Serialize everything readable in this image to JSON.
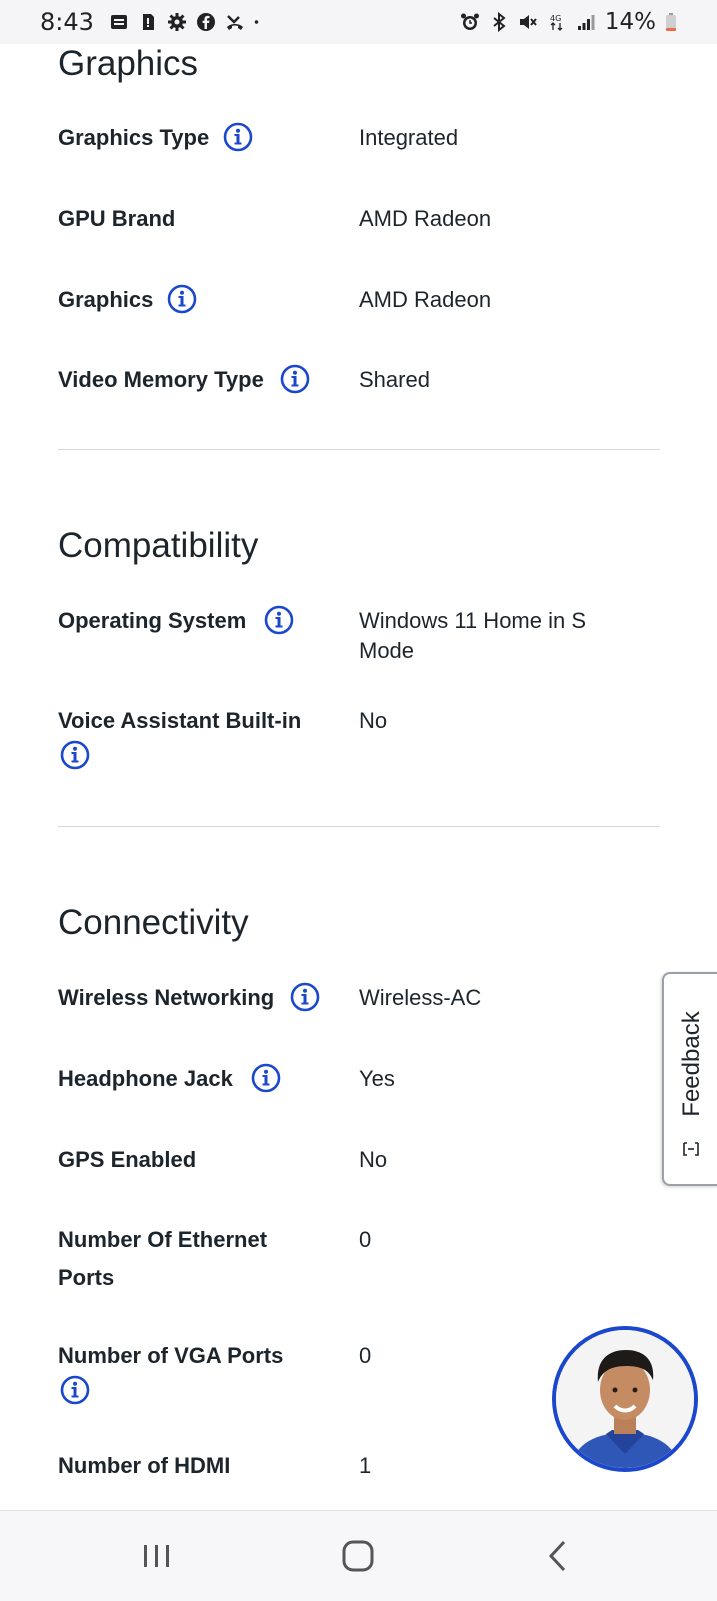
{
  "status_bar": {
    "time": "8:43",
    "battery_text": "14%",
    "left_icons": [
      "notes-icon",
      "sim-icon",
      "settings-icon",
      "facebook-icon",
      "missed-call-icon",
      "dot-icon"
    ],
    "right_icons": [
      "alarm-icon",
      "bluetooth-icon",
      "mute-icon",
      "data-icon",
      "signal-icon",
      "battery-icon"
    ]
  },
  "sections": {
    "graphics": {
      "title": "Graphics",
      "rows": [
        {
          "label": "Graphics Type",
          "value": "Integrated",
          "info": true
        },
        {
          "label": "GPU Brand",
          "value": "AMD Radeon",
          "info": false
        },
        {
          "label": "Graphics",
          "value": "AMD Radeon",
          "info": true
        },
        {
          "label": "Video Memory Type",
          "value": "Shared",
          "info": true
        }
      ]
    },
    "compatibility": {
      "title": "Compatibility",
      "rows": [
        {
          "label": "Operating System",
          "value": "Windows 11 Home in S Mode",
          "info": true
        },
        {
          "label": "Voice Assistant Built-in",
          "value": "No",
          "info": true
        }
      ]
    },
    "connectivity": {
      "title": "Connectivity",
      "rows": [
        {
          "label": "Wireless Networking",
          "value": "Wireless-AC",
          "info": true
        },
        {
          "label": "Headphone Jack",
          "value": "Yes",
          "info": true
        },
        {
          "label": "GPS Enabled",
          "value": "No",
          "info": false
        },
        {
          "label": "Number Of Ethernet Ports",
          "value": "0",
          "info": false
        },
        {
          "label": "Number of VGA Ports",
          "value": "0",
          "info": true
        },
        {
          "label": "Number of HDMI",
          "value": "1",
          "info": false
        }
      ]
    }
  },
  "feedback_tab": {
    "label": "Feedback"
  },
  "colors": {
    "accent": "#1b47cc",
    "text": "#1d252c",
    "divider": "#d4d6d9"
  },
  "nav_bar": {
    "buttons": [
      "recent-apps-icon",
      "home-icon",
      "back-icon"
    ]
  }
}
